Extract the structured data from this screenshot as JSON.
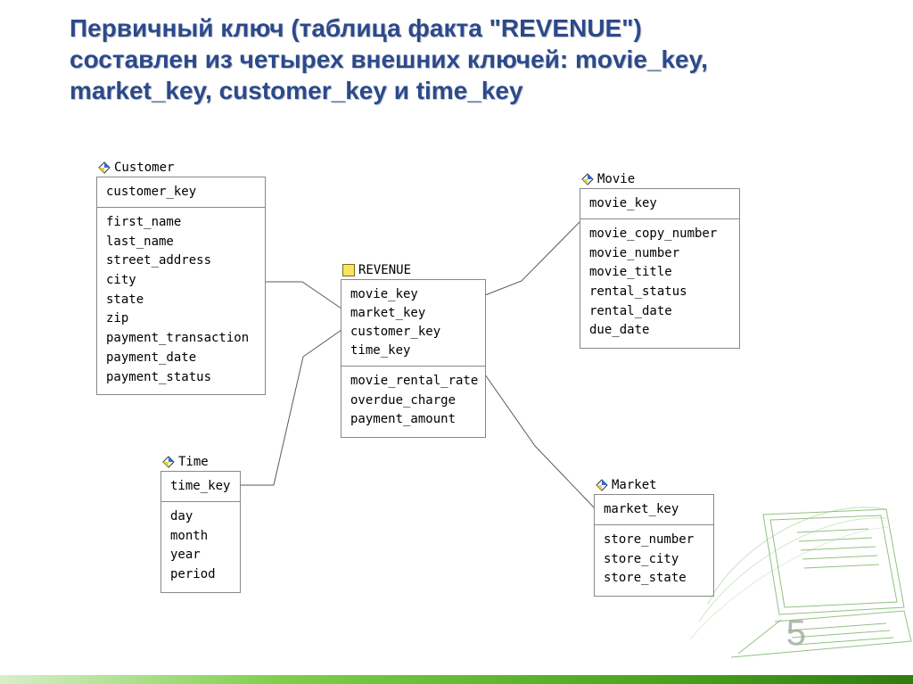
{
  "heading_lines": [
    "Первичный ключ (таблица факта \"REVENUE\")",
    "составлен из четырех внешних ключей: movie_key,",
    "market_key, customer_key и time_key"
  ],
  "entities": {
    "customer": {
      "label": "Customer",
      "pk": [
        "customer_key"
      ],
      "attrs": [
        "first_name",
        "last_name",
        "street_address",
        "city",
        "state",
        "zip",
        "payment_transaction",
        "payment_date",
        "payment_status"
      ]
    },
    "revenue": {
      "label": "REVENUE",
      "pk": [
        "movie_key",
        "market_key",
        "customer_key",
        "time_key"
      ],
      "attrs": [
        "movie_rental_rate",
        "overdue_charge",
        "payment_amount"
      ]
    },
    "movie": {
      "label": "Movie",
      "pk": [
        "movie_key"
      ],
      "attrs": [
        "movie_copy_number",
        "movie_number",
        "movie_title",
        "rental_status",
        "rental_date",
        "due_date"
      ]
    },
    "time": {
      "label": "Time",
      "pk": [
        "time_key"
      ],
      "attrs": [
        "day",
        "month",
        "year",
        "period"
      ]
    },
    "market": {
      "label": "Market",
      "pk": [
        "market_key"
      ],
      "attrs": [
        "store_number",
        "store_city",
        "store_state"
      ]
    }
  },
  "page_number": "5"
}
